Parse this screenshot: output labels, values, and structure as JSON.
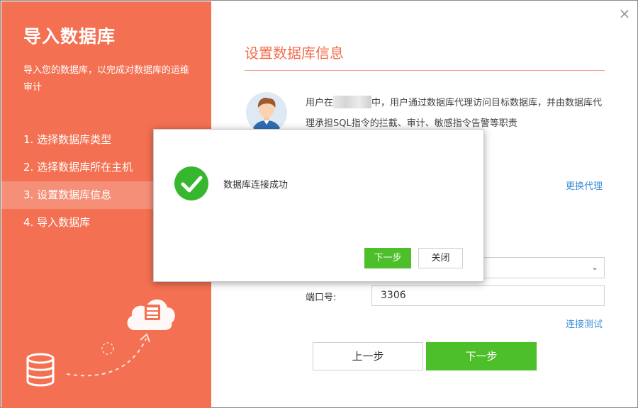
{
  "sidebar": {
    "title": "导入数据库",
    "description": "导入您的数据库，以完成对数据库的运维审计",
    "steps": [
      {
        "label": "1. 选择数据库类型",
        "active": false
      },
      {
        "label": "2. 选择数据库所在主机",
        "active": false
      },
      {
        "label": "3. 设置数据库信息",
        "active": true
      },
      {
        "label": "4. 导入数据库",
        "active": false
      }
    ],
    "color": "#f47052"
  },
  "main": {
    "title": "设置数据库信息",
    "intro_before": "用户在",
    "intro_after": "中，用户通过数据库代理访问目标数据库，并由数据库代理承担SQL指令的拦截、审计、敏感指令告警等职责",
    "change_proxy_link": "更换代理",
    "port_label": "端口号:",
    "port_value": "3306",
    "test_connection_link": "连接测试",
    "prev_button": "上一步",
    "next_button": "下一步"
  },
  "modal": {
    "message": "数据库连接成功",
    "next_button": "下一步",
    "close_button": "关闭",
    "icon": "success-check-icon"
  },
  "colors": {
    "accent": "#f47052",
    "primary_button": "#4cbf2b",
    "link": "#3a8fd6",
    "success": "#36b72d"
  }
}
